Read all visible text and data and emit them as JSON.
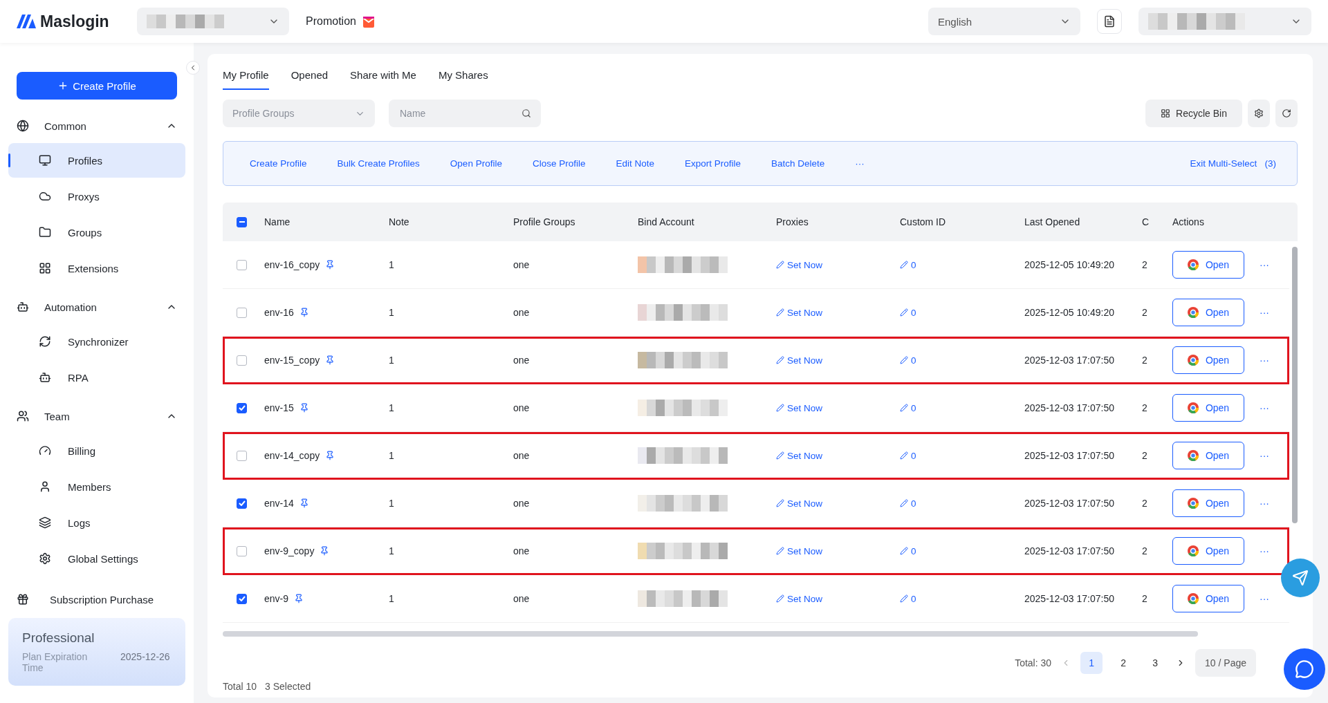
{
  "header": {
    "logo": "Maslogin",
    "promotion": "Promotion",
    "language": "English"
  },
  "sidebar": {
    "create_button": "Create Profile",
    "sections": [
      {
        "label": "Common",
        "expanded": true,
        "children": [
          {
            "label": "Profiles",
            "selected": true
          },
          {
            "label": "Proxys",
            "selected": false
          },
          {
            "label": "Groups",
            "selected": false
          },
          {
            "label": "Extensions",
            "selected": false
          }
        ]
      },
      {
        "label": "Automation",
        "expanded": true,
        "children": [
          {
            "label": "Synchronizer",
            "selected": false
          },
          {
            "label": "RPA",
            "selected": false
          }
        ]
      },
      {
        "label": "Team",
        "expanded": true,
        "children": [
          {
            "label": "Billing",
            "selected": false
          },
          {
            "label": "Members",
            "selected": false
          },
          {
            "label": "Logs",
            "selected": false
          },
          {
            "label": "Global Settings",
            "selected": false
          }
        ]
      }
    ],
    "extra_item": "Subscription Purchase",
    "plan": {
      "name": "Professional",
      "label": "Plan Expiration Time",
      "date": "2025-12-26"
    }
  },
  "tabs": [
    {
      "label": "My Profile",
      "selected": true
    },
    {
      "label": "Opened",
      "selected": false
    },
    {
      "label": "Share with Me",
      "selected": false
    },
    {
      "label": "My Shares",
      "selected": false
    }
  ],
  "filters": {
    "group_placeholder": "Profile Groups",
    "name_placeholder": "Name",
    "recycle_bin": "Recycle Bin"
  },
  "bulk_actions": [
    "Create Profile",
    "Bulk Create Profiles",
    "Open Profile",
    "Close Profile",
    "Edit Note",
    "Export Profile",
    "Batch Delete",
    "···"
  ],
  "exit_multi_select": "Exit Multi-Select",
  "selected_count": "(3)",
  "table": {
    "header_indeterminate": true,
    "columns": [
      "Name",
      "Note",
      "Profile Groups",
      "Bind Account",
      "Proxies",
      "Custom ID",
      "Last Opened",
      "C",
      "Actions"
    ],
    "rows": [
      {
        "name": "env-16_copy",
        "note": "1",
        "group": "one",
        "proxy": "Set Now",
        "custom_id": "0",
        "last_opened": "2025-12-05 10:49:20",
        "column_8": "2",
        "action": "Open",
        "more": "···",
        "checked": false,
        "highlighted": false
      },
      {
        "name": "env-16",
        "note": "1",
        "group": "one",
        "proxy": "Set Now",
        "custom_id": "0",
        "last_opened": "2025-12-05 10:49:20",
        "column_8": "2",
        "action": "Open",
        "more": "···",
        "checked": false,
        "highlighted": false
      },
      {
        "name": "env-15_copy",
        "note": "1",
        "group": "one",
        "proxy": "Set Now",
        "custom_id": "0",
        "last_opened": "2025-12-03 17:07:50",
        "column_8": "2",
        "action": "Open",
        "more": "···",
        "checked": false,
        "highlighted": true
      },
      {
        "name": "env-15",
        "note": "1",
        "group": "one",
        "proxy": "Set Now",
        "custom_id": "0",
        "last_opened": "2025-12-03 17:07:50",
        "column_8": "2",
        "action": "Open",
        "more": "···",
        "checked": true,
        "highlighted": false
      },
      {
        "name": "env-14_copy",
        "note": "1",
        "group": "one",
        "proxy": "Set Now",
        "custom_id": "0",
        "last_opened": "2025-12-03 17:07:50",
        "column_8": "2",
        "action": "Open",
        "more": "···",
        "checked": false,
        "highlighted": true
      },
      {
        "name": "env-14",
        "note": "1",
        "group": "one",
        "proxy": "Set Now",
        "custom_id": "0",
        "last_opened": "2025-12-03 17:07:50",
        "column_8": "2",
        "action": "Open",
        "more": "···",
        "checked": true,
        "highlighted": false
      },
      {
        "name": "env-9_copy",
        "note": "1",
        "group": "one",
        "proxy": "Set Now",
        "custom_id": "0",
        "last_opened": "2025-12-03 17:07:50",
        "column_8": "2",
        "action": "Open",
        "more": "···",
        "checked": false,
        "highlighted": true
      },
      {
        "name": "env-9",
        "note": "1",
        "group": "one",
        "proxy": "Set Now",
        "custom_id": "0",
        "last_opened": "2025-12-03 17:07:50",
        "column_8": "2",
        "action": "Open",
        "more": "···",
        "checked": true,
        "highlighted": false
      }
    ]
  },
  "pagination": {
    "total": "Total: 30",
    "pages": [
      {
        "label": "1",
        "selected": true
      },
      {
        "label": "2",
        "selected": false
      },
      {
        "label": "3",
        "selected": false
      }
    ],
    "page_size": "10 / Page"
  },
  "footer": {
    "total": "Total 10",
    "selected": "3 Selected"
  }
}
